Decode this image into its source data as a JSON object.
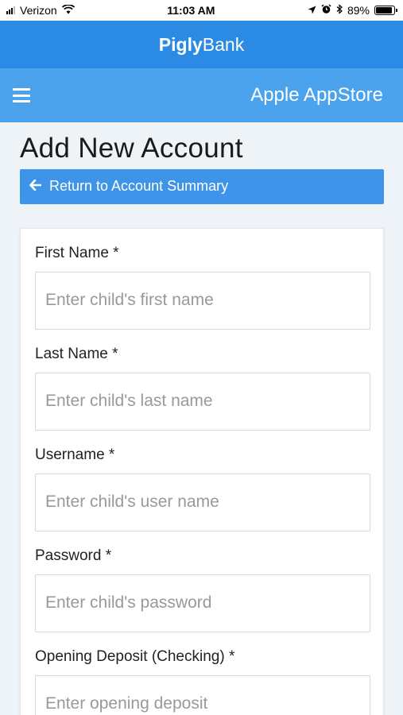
{
  "status_bar": {
    "carrier": "Verizon",
    "time": "11:03 AM",
    "battery": "89%",
    "battery_level": 0.89
  },
  "brand": {
    "name_bold": "Pigly",
    "name_regular": "Bank"
  },
  "nav": {
    "title": "Apple AppStore"
  },
  "page": {
    "title": "Add New Account",
    "return_label": "Return to Account Summary"
  },
  "form": {
    "fields": [
      {
        "label": "First Name *",
        "placeholder": "Enter child's first name"
      },
      {
        "label": "Last Name *",
        "placeholder": "Enter child's last name"
      },
      {
        "label": "Username *",
        "placeholder": "Enter child's user name"
      },
      {
        "label": "Password *",
        "placeholder": "Enter child's password"
      },
      {
        "label": "Opening Deposit (Checking) *",
        "placeholder": "Enter opening deposit"
      }
    ]
  },
  "colors": {
    "brand_bar": "#2b8be4",
    "nav_bar": "#4ba3ee",
    "button": "#3d94e8",
    "background": "#eef3f8"
  }
}
